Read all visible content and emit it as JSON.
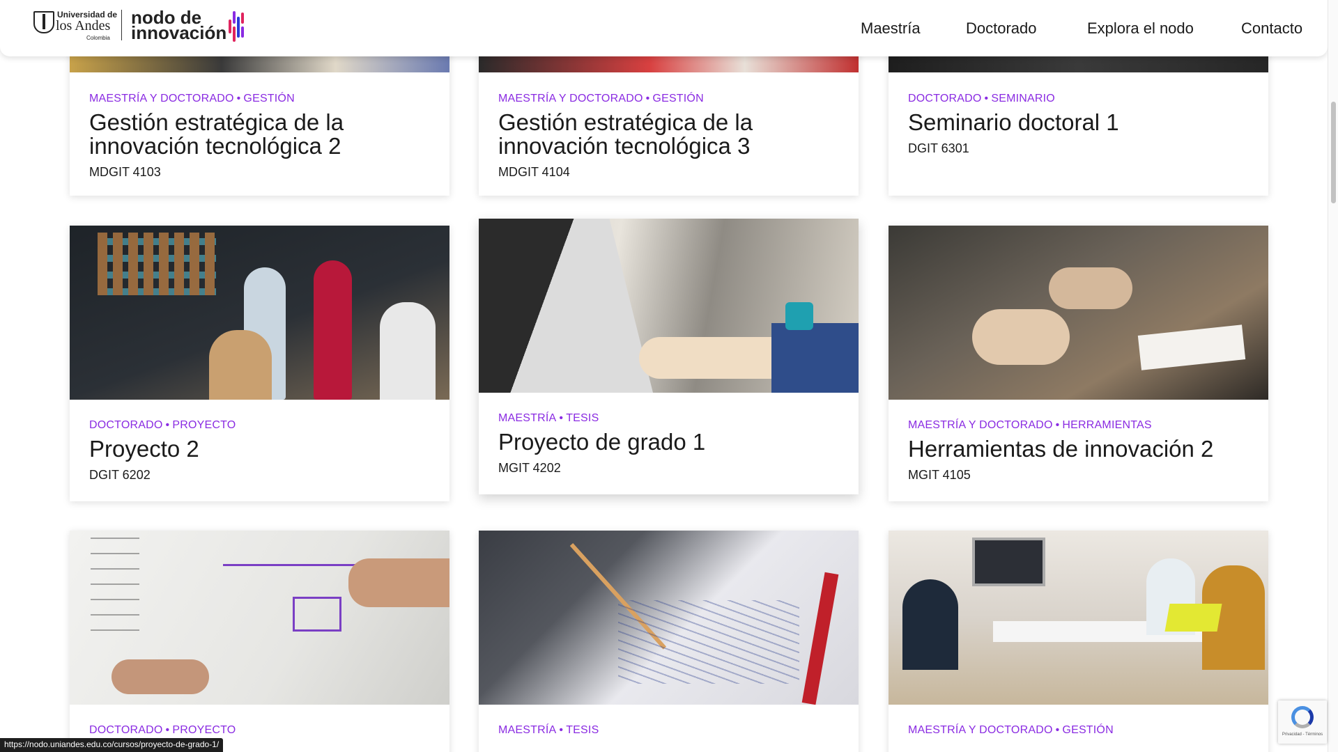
{
  "header": {
    "logo_uniandes": {
      "line1": "Universidad de",
      "line2": "los Andes",
      "line3": "Colombia"
    },
    "logo_nodo": {
      "line1": "nodo de",
      "line2": "innovación"
    },
    "nav": [
      {
        "label": "Maestría"
      },
      {
        "label": "Doctorado"
      },
      {
        "label": "Explora el nodo"
      },
      {
        "label": "Contacto"
      }
    ]
  },
  "cards": [
    {
      "meta1": "MAESTRÍA Y DOCTORADO",
      "meta2": "GESTIÓN",
      "title": "Gestión estratégica de la innovación tecnológica 2",
      "code": "MDGIT 4103"
    },
    {
      "meta1": "MAESTRÍA Y DOCTORADO",
      "meta2": "GESTIÓN",
      "title": "Gestión estratégica de la innovación tecnológica 3",
      "code": "MDGIT 4104"
    },
    {
      "meta1": "DOCTORADO",
      "meta2": "SEMINARIO",
      "title": "Seminario doctoral 1",
      "code": "DGIT 6301"
    },
    {
      "meta1": "DOCTORADO",
      "meta2": "PROYECTO",
      "title": "Proyecto 2",
      "code": "DGIT 6202"
    },
    {
      "meta1": "MAESTRÍA",
      "meta2": "TESIS",
      "title": "Proyecto de grado 1",
      "code": "MGIT 4202"
    },
    {
      "meta1": "MAESTRÍA Y DOCTORADO",
      "meta2": "HERRAMIENTAS",
      "title": "Herramientas de innovación 2",
      "code": "MGIT 4105"
    },
    {
      "meta1": "DOCTORADO",
      "meta2": "PROYECTO"
    },
    {
      "meta1": "MAESTRÍA",
      "meta2": "TESIS"
    },
    {
      "meta1": "MAESTRÍA Y DOCTORADO",
      "meta2": "GESTIÓN"
    }
  ],
  "meta_separator": "•",
  "status_url": "https://nodo.uniandes.edu.co/cursos/proyecto-de-grado-1/",
  "recaptcha": {
    "text": "Privacidad - Términos",
    "icon": "recaptcha-icon"
  },
  "colors": {
    "accent": "#8a2be2",
    "text": "#1a1a1a",
    "background": "#ffffff"
  }
}
